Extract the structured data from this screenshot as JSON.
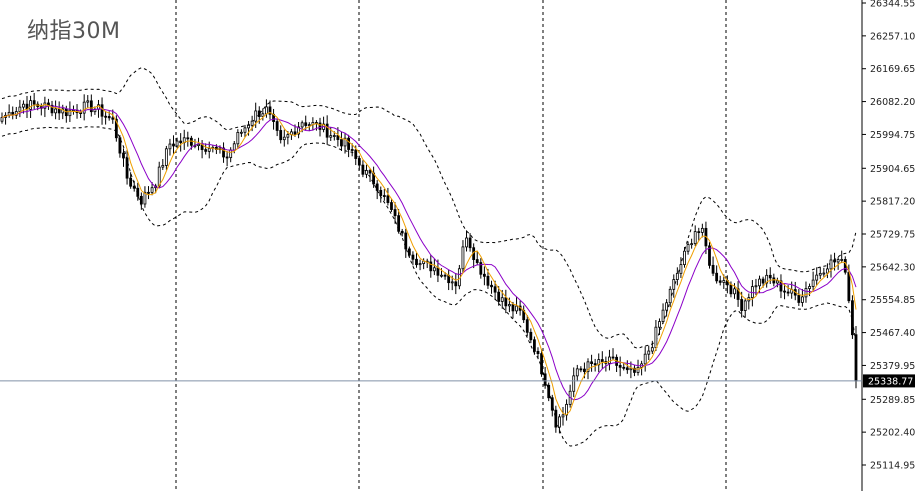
{
  "chart_data": {
    "type": "candlestick",
    "title": "纳指30M",
    "ylim": [
      25090,
      26350
    ],
    "y_ticks": [
      "26344.55",
      "26257.10",
      "26169.65",
      "26082.20",
      "25994.75",
      "25904.65",
      "25817.20",
      "25729.75",
      "25642.30",
      "25554.85",
      "25467.40",
      "25379.95",
      "25289.85",
      "25202.40",
      "25114.95"
    ],
    "current_price": "25338.77",
    "overlays": [
      "Bollinger Bands (dashed)",
      "Moving average (purple)",
      "Moving average (orange)"
    ],
    "grid": "vertical dashed separators",
    "close_anchors": [
      [
        0,
        26040
      ],
      [
        6,
        26075
      ],
      [
        12,
        26070
      ],
      [
        18,
        26055
      ],
      [
        24,
        26070
      ],
      [
        27,
        26060
      ],
      [
        31,
        26030
      ],
      [
        35,
        25880
      ],
      [
        39,
        25820
      ],
      [
        43,
        25870
      ],
      [
        47,
        25970
      ],
      [
        52,
        25980
      ],
      [
        58,
        25960
      ],
      [
        63,
        25935
      ],
      [
        66,
        25990
      ],
      [
        71,
        26050
      ],
      [
        74,
        26060
      ],
      [
        78,
        25970
      ],
      [
        84,
        26030
      ],
      [
        89,
        26015
      ],
      [
        96,
        25970
      ],
      [
        101,
        25900
      ],
      [
        105,
        25860
      ],
      [
        109,
        25790
      ],
      [
        113,
        25700
      ],
      [
        117,
        25650
      ],
      [
        121,
        25640
      ],
      [
        124,
        25620
      ],
      [
        127,
        25600
      ],
      [
        130,
        25730
      ],
      [
        133,
        25650
      ],
      [
        137,
        25590
      ],
      [
        141,
        25540
      ],
      [
        145,
        25520
      ],
      [
        149,
        25430
      ],
      [
        152,
        25340
      ],
      [
        155,
        25230
      ],
      [
        157,
        25250
      ],
      [
        161,
        25370
      ],
      [
        165,
        25380
      ],
      [
        171,
        25390
      ],
      [
        175,
        25360
      ],
      [
        178,
        25360
      ],
      [
        182,
        25440
      ],
      [
        186,
        25550
      ],
      [
        190,
        25650
      ],
      [
        194,
        25740
      ],
      [
        196,
        25730
      ],
      [
        199,
        25620
      ],
      [
        203,
        25600
      ],
      [
        207,
        25540
      ],
      [
        211,
        25600
      ],
      [
        215,
        25610
      ],
      [
        219,
        25580
      ],
      [
        223,
        25560
      ],
      [
        227,
        25610
      ],
      [
        231,
        25650
      ],
      [
        234,
        25660
      ],
      [
        236,
        25640
      ],
      [
        238,
        25470
      ],
      [
        239,
        25338.77
      ]
    ]
  },
  "colors": {
    "candle": "#000000",
    "bollinger": "#000000",
    "ma_fast": "#f0a000",
    "ma_slow": "#8b00c8",
    "price_line": "#8090a8",
    "price_tag_bg": "#000000",
    "price_tag_text": "#ffffff"
  }
}
